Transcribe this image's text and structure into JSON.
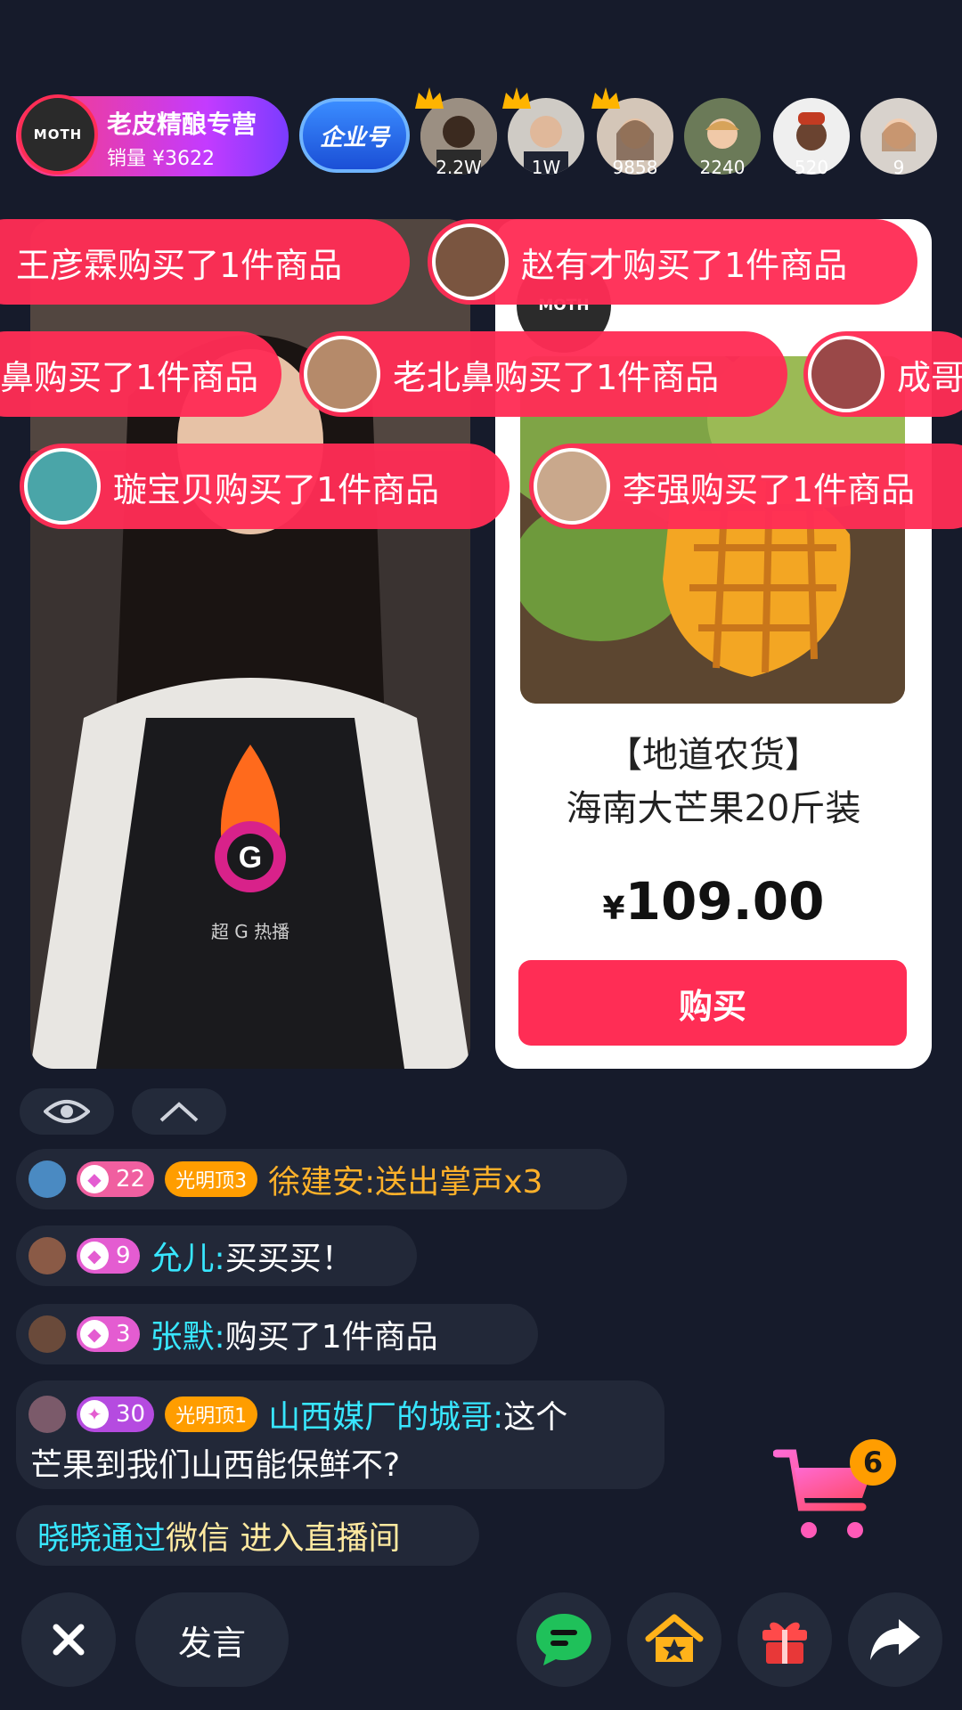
{
  "shop": {
    "logo_text": "MOTH",
    "name": "老皮精酿专营",
    "sales": "销量 ¥3622"
  },
  "enterprise_badge": "企业号",
  "viewers": [
    {
      "count": "2.2W",
      "crown": true
    },
    {
      "count": "1W",
      "crown": true
    },
    {
      "count": "9858",
      "crown": true
    },
    {
      "count": "2240",
      "crown": false
    },
    {
      "count": "520",
      "crown": false
    },
    {
      "count": "9",
      "crown": false
    }
  ],
  "video": {
    "apron_brand": "超 G 热播"
  },
  "notifications": [
    {
      "text": "王彦霖购买了1件商品"
    },
    {
      "text": "赵有才购买了1件商品"
    },
    {
      "text": "鼻购买了1件商品"
    },
    {
      "text": "老北鼻购买了1件商品"
    },
    {
      "text": "成哥"
    },
    {
      "text": "璇宝贝购买了1件商品"
    },
    {
      "text": "李强购买了1件商品"
    }
  ],
  "product": {
    "shop_logo": "MOTH",
    "title_line1": "【地道农货】",
    "title_line2": "海南大芒果20斤装",
    "currency": "¥",
    "price": "109.00",
    "buy_label": "购买"
  },
  "chat": [
    {
      "level": "22",
      "rank": "光明顶3",
      "name": "徐建安:",
      "message": "送出掌声x3"
    },
    {
      "level": "9",
      "name": "允儿:",
      "message": "买买买！"
    },
    {
      "level": "3",
      "name": "张默:",
      "message": " 购买了1件商品"
    },
    {
      "level": "30",
      "rank": "光明顶1",
      "name": "山西媒厂的城哥:",
      "message": " 这个",
      "message_line2": "芒果到我们山西能保鲜不?"
    },
    {
      "name": "晓晓通过",
      "message": " 微信 进入直播间"
    }
  ],
  "bottom": {
    "speak_label": "发言",
    "cart_count": "6"
  },
  "colors": {
    "background": "#161b2b",
    "accent": "#ff2d55",
    "name_cyan": "#38e6ff",
    "name_orange": "#ffb12a",
    "rank_orange": "#ff9d00"
  },
  "icons": [
    "close-icon",
    "chat-icon",
    "home-icon",
    "gift-icon",
    "share-icon",
    "cart-icon",
    "eye-icon",
    "chevron-up-icon",
    "crown-icon",
    "gem-icon"
  ]
}
